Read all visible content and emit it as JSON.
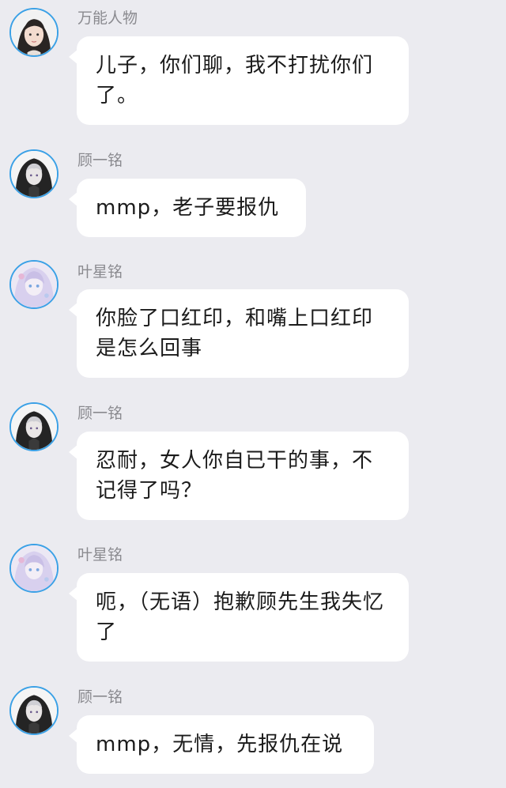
{
  "messages": [
    {
      "avatar_icon": "girl-photo-avatar-icon",
      "name": "万能人物",
      "text": "儿子，你们聊，我不打扰你们了。"
    },
    {
      "avatar_icon": "hooded-boy-avatar-icon",
      "name": "顾一铭",
      "text": "mmp，老子要报仇"
    },
    {
      "avatar_icon": "anime-girl-avatar-icon",
      "name": "叶星铭",
      "text": "你脸了口红印，和嘴上口红印是怎么回事"
    },
    {
      "avatar_icon": "hooded-boy-avatar-icon",
      "name": "顾一铭",
      "text": "忍耐，女人你自已干的事，不记得了吗？"
    },
    {
      "avatar_icon": "anime-girl-avatar-icon",
      "name": "叶星铭",
      "text": "呃，（无语）抱歉顾先生我失忆了"
    },
    {
      "avatar_icon": "hooded-boy-avatar-icon",
      "name": "顾一铭",
      "text": "mmp，无情，先报仇在说"
    }
  ],
  "colors": {
    "background": "#ebebf0",
    "bubble": "#ffffff",
    "avatar_ring": "#3ba1e6",
    "name_text": "#8a8a8f",
    "message_text": "#1b1b1b"
  }
}
